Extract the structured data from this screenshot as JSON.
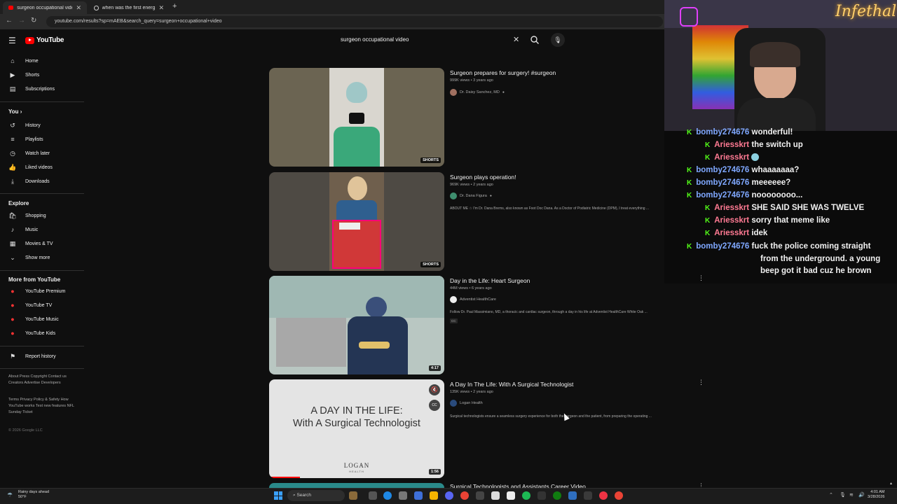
{
  "browser": {
    "tabs": [
      {
        "label": "surgeon occupational video - Yo",
        "icon": "youtube-favicon"
      },
      {
        "label": "when was the first energy drink",
        "icon": "google-favicon"
      }
    ],
    "url": "youtube.com/results?sp=mAEB&search_query=surgeon+occupational+video"
  },
  "youtube": {
    "brand": "YouTube",
    "search_value": "surgeon occupational video",
    "sidebar": {
      "main": [
        {
          "label": "Home",
          "icon": "home-icon"
        },
        {
          "label": "Shorts",
          "icon": "shorts-icon"
        },
        {
          "label": "Subscriptions",
          "icon": "subscriptions-icon"
        }
      ],
      "you_heading": "You",
      "you": [
        {
          "label": "History",
          "icon": "history-icon"
        },
        {
          "label": "Playlists",
          "icon": "playlists-icon"
        },
        {
          "label": "Watch later",
          "icon": "clock-icon"
        },
        {
          "label": "Liked videos",
          "icon": "thumbs-up-icon"
        },
        {
          "label": "Downloads",
          "icon": "download-icon"
        }
      ],
      "explore_heading": "Explore",
      "explore": [
        {
          "label": "Shopping",
          "icon": "shopping-icon"
        },
        {
          "label": "Music",
          "icon": "music-icon"
        },
        {
          "label": "Movies & TV",
          "icon": "movies-icon"
        },
        {
          "label": "Show more",
          "icon": "chevron-down-icon"
        }
      ],
      "more_heading": "More from YouTube",
      "more": [
        {
          "label": "YouTube Premium"
        },
        {
          "label": "YouTube TV"
        },
        {
          "label": "YouTube Music"
        },
        {
          "label": "YouTube Kids"
        }
      ],
      "report": "Report history",
      "footer1": "About  Press  Copyright  Contact us  Creators  Advertise  Developers",
      "footer2": "Terms  Privacy  Policy & Safety  How YouTube works  Test new features  NFL Sunday Ticket",
      "copyright": "© 2026 Google LLC"
    },
    "results": [
      {
        "title": "Surgeon prepares for surgery! #surgeon",
        "meta": "999K views • 3 years ago",
        "channel": "Dr. Daisy Sanchez, MD",
        "badge": "SHORTS",
        "desc": ""
      },
      {
        "title": "Surgeon plays operation!",
        "meta": "969K views • 2 years ago",
        "channel": "Dr. Dana Figura",
        "badge": "SHORTS",
        "desc": "ABOUT ME ☆ I'm Dr. Dana Brems, also known as Foot Doc Dana. As a Doctor of Podiatric Medicine (DPM), I treat everything ..."
      },
      {
        "title": "Day in the Life: Heart Surgeon",
        "meta": "44M views • 6 years ago",
        "channel": "Adventist HealthCare",
        "badge": "4:17",
        "desc": "Follow Dr. Paul Massimiano, MD, a thoracic and cardiac surgeon, through a day in his life at Adventist HealthCare White Oak ...",
        "cc": "CC"
      },
      {
        "title": "A Day In The Life: With A Surgical Technologist",
        "meta": "135K views • 2 years ago",
        "channel": "Logan Health",
        "badge": "1:56",
        "desc": "Surgical technologists ensure a seamless surgery experience for both the surgeon and the patient, from preparing the operating ...",
        "thumb_line1": "A DAY IN THE LIFE:",
        "thumb_line2": "With A Surgical Technologist",
        "thumb_brand": "LOGAN",
        "thumb_brand_sub": "HEALTH"
      },
      {
        "title": "Surgical Technologists and Assistants Career Video",
        "meta": "",
        "channel": "",
        "badge": "",
        "desc": ""
      }
    ]
  },
  "stream": {
    "neon_sign": "Infethal",
    "chat": [
      {
        "user": "bomby274676",
        "text": "wonderful!",
        "color": "#7fa8ff"
      },
      {
        "user": "Ariesskrt",
        "text": "the switch up",
        "color": "#ff7a93"
      },
      {
        "user": "Ariesskrt",
        "text": "",
        "color": "#ff7a93",
        "emote": "emote-icon"
      },
      {
        "user": "bomby274676",
        "text": "whaaaaaaa?",
        "color": "#7fa8ff"
      },
      {
        "user": "bomby274676",
        "text": "meeeeee?",
        "color": "#7fa8ff"
      },
      {
        "user": "bomby274676",
        "text": "noooooooo...",
        "color": "#7fa8ff"
      },
      {
        "user": "Ariesskrt",
        "text": "SHE SAID SHE WAS TWELVE",
        "color": "#ff7a93"
      },
      {
        "user": "Ariesskrt",
        "text": "sorry that meme like",
        "color": "#ff7a93"
      },
      {
        "user": "Ariesskrt",
        "text": "idek",
        "color": "#ff7a93"
      },
      {
        "user": "bomby274676",
        "text": "fuck the police coming straight",
        "color": "#7fa8ff"
      }
    ],
    "chat_wrap": [
      "from the underground. a young",
      "beep got it bad cuz he brown"
    ]
  },
  "taskbar": {
    "weather_line1": "Rainy days ahead",
    "weather_line2": "50°F",
    "search_label": "Search",
    "time": "4:01 AM",
    "date": "3/28/2026"
  }
}
